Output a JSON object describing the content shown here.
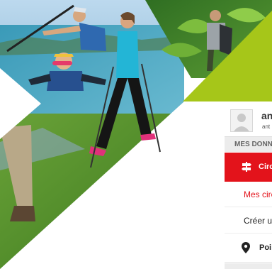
{
  "user": {
    "name": "an",
    "subtitle": "ant"
  },
  "sidebar": {
    "section_heading": "MES DONN",
    "items": [
      {
        "label": "Circ",
        "icon": "signpost-icon",
        "active": true
      },
      {
        "label": "Mes circ",
        "type": "subitem",
        "selected": true
      },
      {
        "label": "Créer u",
        "type": "subitem"
      },
      {
        "label": "Poi",
        "icon": "map-pin-icon"
      }
    ]
  },
  "colors": {
    "accent_red": "#e3131b",
    "lime_green": "#a6c619",
    "section_gray": "#ececec"
  }
}
